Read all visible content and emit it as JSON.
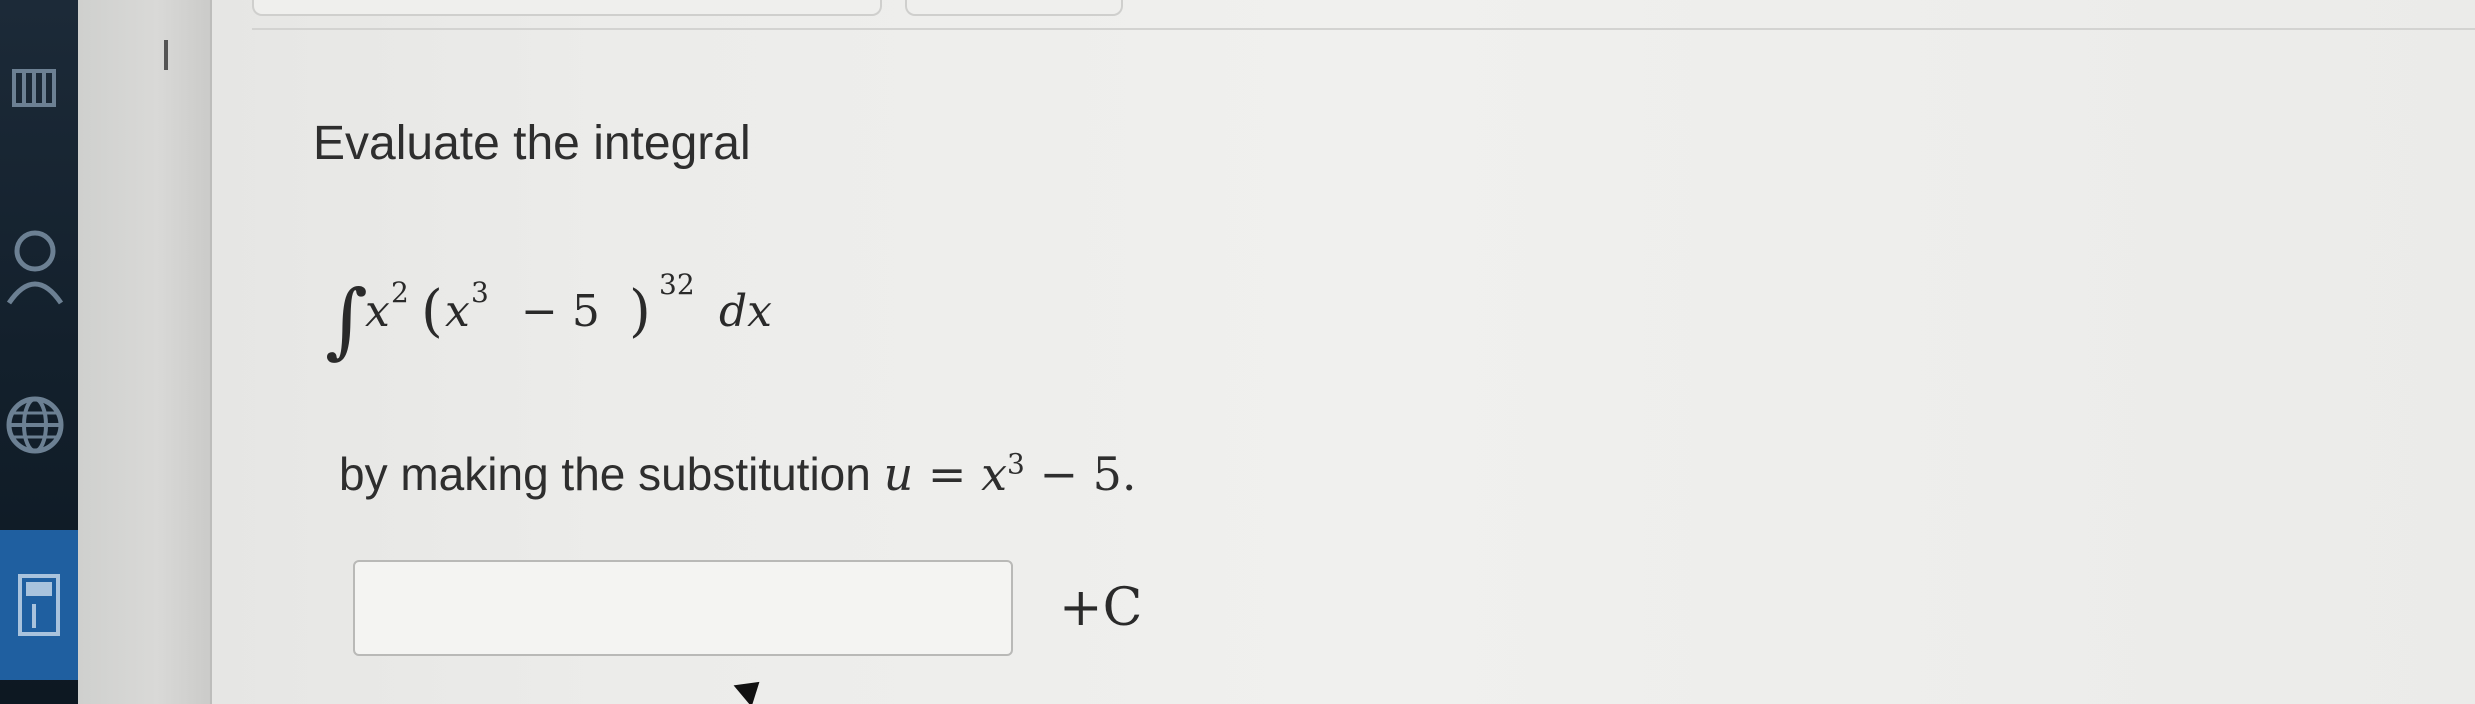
{
  "question": {
    "prompt": "Evaluate the integral",
    "integral": {
      "integral_sign": "∫",
      "factor_base": "x",
      "factor_exp": "2",
      "open_paren": "(",
      "inner_base": "x",
      "inner_exp": "3",
      "inner_rest": "− 5",
      "close_paren": ")",
      "outer_exp": "32",
      "differential": "dx"
    },
    "substitution_prefix": "by making the substitution",
    "substitution_var": "u",
    "substitution_eq": " = ",
    "substitution_base": "x",
    "substitution_exp": "3",
    "substitution_rest": " − 5.",
    "answer_value": "",
    "constant_term": "+C"
  },
  "icons": [
    "book-icon",
    "person-icon",
    "globe-icon",
    "calculator-icon",
    "pointer-cursor-icon"
  ],
  "colors": {
    "rail": "#13202c",
    "rail_active": "#1f5fa0",
    "panel": "#d6d6d4",
    "page": "#ececea",
    "text": "#2e2e2e"
  }
}
